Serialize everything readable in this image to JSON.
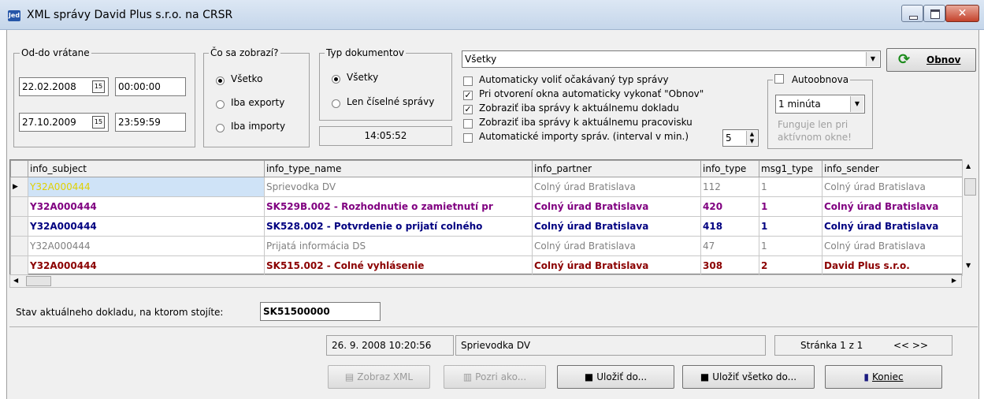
{
  "window": {
    "title": "XML správy David Plus s.r.o. na CRSR",
    "app_icon": "Jed"
  },
  "date_range": {
    "legend": "Od-do vrátane",
    "from_date": "22.02.2008",
    "from_time": "00:00:00",
    "to_date": "27.10.2009",
    "to_time": "23:59:59"
  },
  "show_group": {
    "legend": "Čo sa zobrazí?",
    "options": [
      "Všetko",
      "Iba exporty",
      "Iba importy"
    ],
    "selected": 0
  },
  "doc_type_group": {
    "legend": "Typ dokumentov",
    "options": [
      "Všetky",
      "Len číselné správy"
    ],
    "selected": 0,
    "clock": "14:05:52"
  },
  "type_combo": {
    "value": "Všetky"
  },
  "refresh_button": {
    "label": "Obnov"
  },
  "options": [
    {
      "label": "Automaticky voliť očakávaný typ správy",
      "checked": false
    },
    {
      "label": "Pri otvorení okna automaticky vykonať \"Obnov\"",
      "checked": true
    },
    {
      "label": "Zobraziť iba správy k aktuálnemu dokladu",
      "checked": true
    },
    {
      "label": "Zobraziť iba správy k aktuálnemu pracovisku",
      "checked": false
    },
    {
      "label": "Automatické importy správ. (interval v min.)",
      "checked": false
    }
  ],
  "interval_spinner": {
    "value": "5"
  },
  "autorefresh": {
    "legend": "Autoobnova",
    "checked": false,
    "interval": "1 minúta",
    "note_line1": "Funguje len pri",
    "note_line2": "aktívnom okne!"
  },
  "grid": {
    "columns": [
      "info_subject",
      "info_type_name",
      "info_partner",
      "info_type",
      "msg1_type",
      "info_sender"
    ],
    "rows": [
      {
        "cells": [
          "Y32A000444",
          "Sprievodka DV",
          "Colný úrad Bratislava",
          "112",
          "1",
          "Colný úrad Bratislava"
        ],
        "style": "gray",
        "current": true
      },
      {
        "cells": [
          "Y32A000444",
          "SK529B.002 - Rozhodnutie o zamietnutí pr",
          "Colný úrad Bratislava",
          "420",
          "1",
          "Colný úrad Bratislava"
        ],
        "style": "purple",
        "current": false
      },
      {
        "cells": [
          "Y32A000444",
          "SK528.002 - Potvrdenie o prijatí colného",
          "Colný úrad Bratislava",
          "418",
          "1",
          "Colný úrad Bratislava"
        ],
        "style": "navy",
        "current": false
      },
      {
        "cells": [
          "Y32A000444",
          "Prijatá informácia DS",
          "Colný úrad Bratislava",
          "47",
          "1",
          "Colný úrad Bratislava"
        ],
        "style": "gray",
        "current": false
      },
      {
        "cells": [
          "Y32A000444",
          "SK515.002 - Colné vyhlásenie",
          "Colný úrad Bratislava",
          "308",
          "2",
          "David Plus s.r.o."
        ],
        "style": "maroon",
        "current": false
      }
    ]
  },
  "doc_state": {
    "label": "Stav aktuálneho dokladu, na ktorom stojíte:",
    "value": "SK51500000"
  },
  "status_bar": {
    "datetime": "26. 9. 2008 10:20:56",
    "type": "Sprievodka DV",
    "page": "Stránka 1 z 1",
    "nav": "<<  >>"
  },
  "buttons": {
    "show_xml": "Zobraz XML",
    "view_as": "Pozri ako...",
    "save_to": "Uložiť do...",
    "save_all": "Uložiť všetko do...",
    "close": "Koniec"
  },
  "colors": {
    "gray": "#808080",
    "purple": "#800080",
    "navy": "#000080",
    "maroon": "#8b0000",
    "yellow": "#e0d000",
    "selected": "#cfe3f7",
    "refresh_green": "#1a8a1a"
  }
}
